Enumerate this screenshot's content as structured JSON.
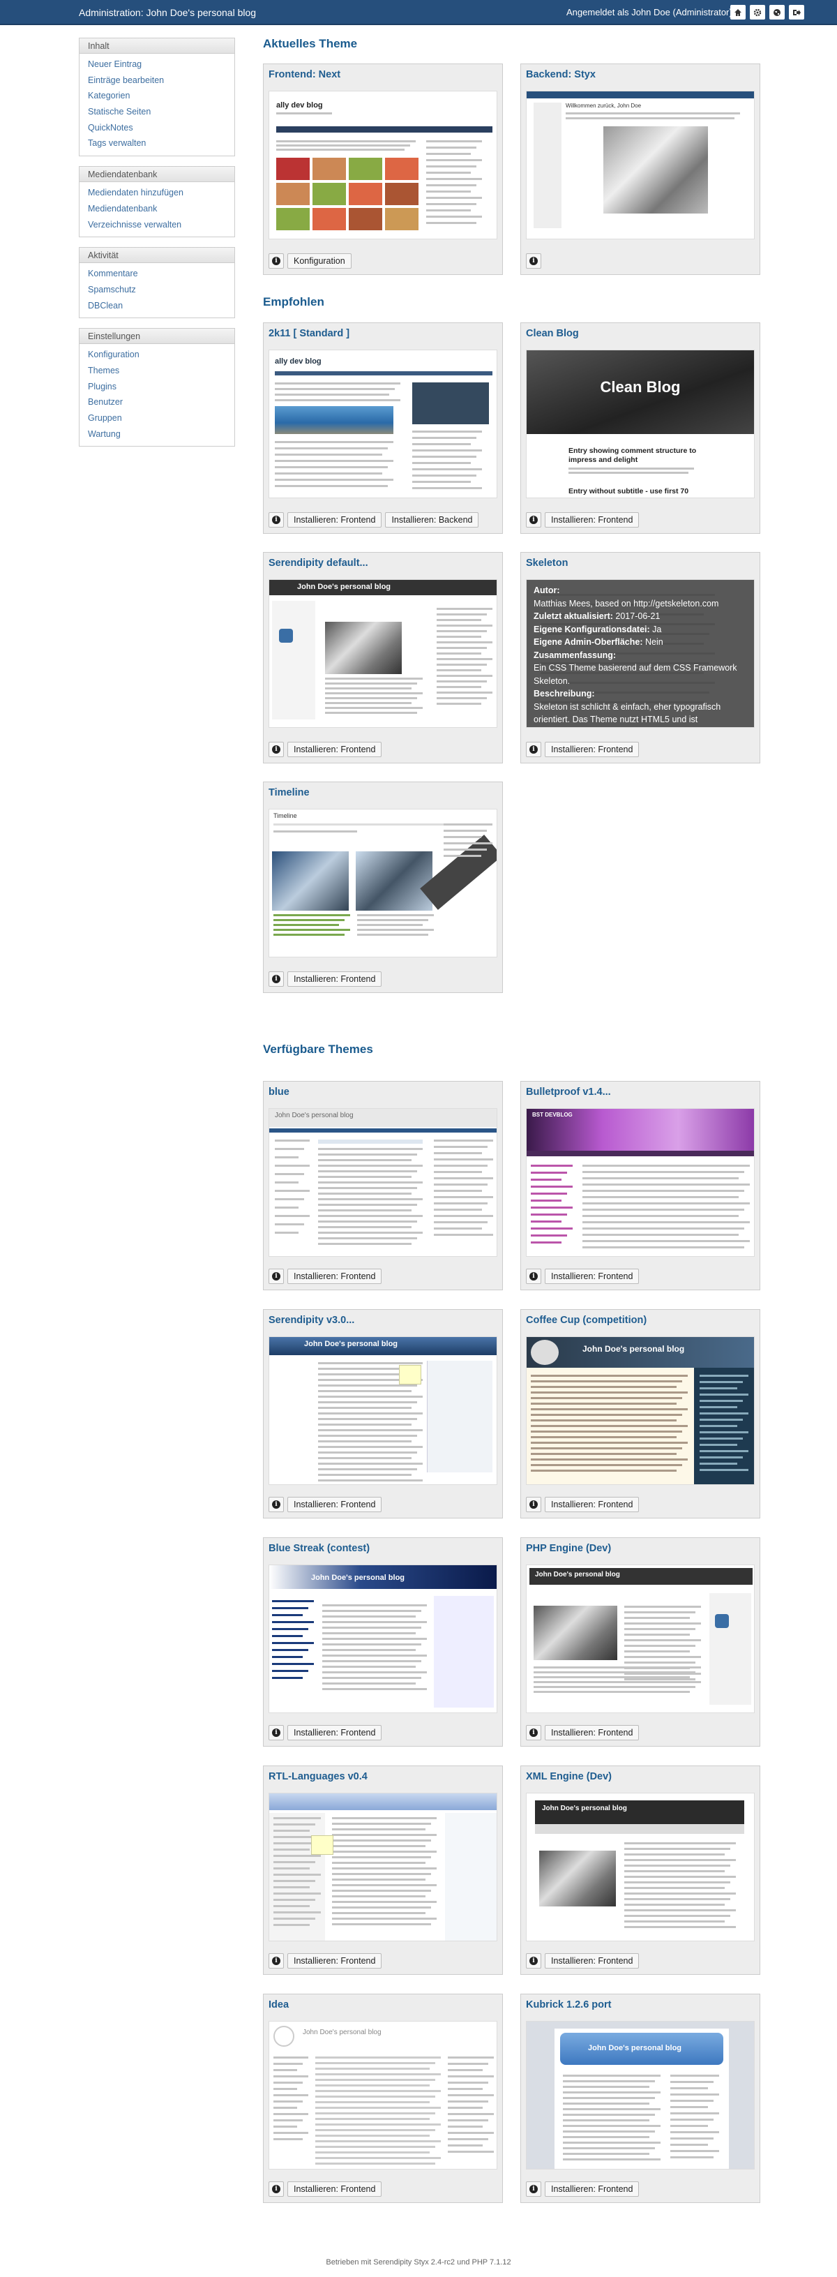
{
  "header": {
    "title": "Administration: John Doe's personal blog",
    "login": "Angemeldet als John Doe (Administrator)",
    "icons": [
      "home-icon",
      "settings-icon",
      "globe-icon",
      "logout-icon"
    ]
  },
  "sidebar": [
    {
      "title": "Inhalt",
      "items": [
        "Neuer Eintrag",
        "Einträge bearbeiten",
        "Kategorien",
        "Statische Seiten",
        "QuickNotes",
        "Tags verwalten"
      ]
    },
    {
      "title": "Mediendatenbank",
      "items": [
        "Mediendaten hinzufügen",
        "Mediendatenbank",
        "Verzeichnisse verwalten"
      ]
    },
    {
      "title": "Aktivität",
      "items": [
        "Kommentare",
        "Spamschutz",
        "DBClean"
      ]
    },
    {
      "title": "Einstellungen",
      "items": [
        "Konfiguration",
        "Themes",
        "Plugins",
        "Benutzer",
        "Gruppen",
        "Wartung"
      ]
    }
  ],
  "sections": {
    "current": "Aktuelles Theme",
    "recommended": "Empfohlen",
    "available": "Verfügbare Themes"
  },
  "info_label": "i",
  "current": [
    {
      "title": "Frontend: Next",
      "buttons": [
        "Konfiguration"
      ]
    },
    {
      "title": "Backend: Styx",
      "buttons": []
    }
  ],
  "previews": {
    "next_blog": "ally dev blog",
    "styx_welcome": "Willkommen zurück, John Doe",
    "clean_title": "Clean Blog",
    "clean_post1": "Entry showing comment structure to impress and delight",
    "clean_post2": "Entry without subtitle - use first 70",
    "jd_blog": "John Doe's personal blog",
    "bulletproof": "BST DEVBLOG",
    "timeline": "Timeline",
    "s2k11": "ally dev blog"
  },
  "skeleton_overlay": {
    "author_label": "Autor:",
    "author": "Matthias Mees, based on http://getskeleton.com",
    "updated_label": "Zuletzt aktualisiert:",
    "updated": "2017-06-21",
    "config_label": "Eigene Konfigurationsdatei:",
    "config": "Ja",
    "admin_label": "Eigene Admin-Oberfläche:",
    "admin": "Nein",
    "summary_label": "Zusammenfassung:",
    "summary": "Ein CSS Theme basierend auf dem CSS Framework Skeleton.",
    "desc_label": "Beschreibung:",
    "desc": "Skeleton ist schlicht & einfach, eher typografisch orientiert. Das Theme nutzt HTML5 und ist"
  },
  "recommended": [
    {
      "title": "2k11 [ Standard ]",
      "buttons": [
        "Installieren: Frontend",
        "Installieren: Backend"
      ]
    },
    {
      "title": "Clean Blog",
      "buttons": [
        "Installieren: Frontend"
      ]
    },
    {
      "title": "Serendipity default...",
      "buttons": [
        "Installieren: Frontend"
      ]
    },
    {
      "title": "Skeleton",
      "buttons": [
        "Installieren: Frontend"
      ]
    },
    {
      "title": "Timeline",
      "buttons": [
        "Installieren: Frontend"
      ]
    }
  ],
  "available": [
    {
      "title": "blue",
      "buttons": [
        "Installieren: Frontend"
      ]
    },
    {
      "title": "Bulletproof v1.4...",
      "buttons": [
        "Installieren: Frontend"
      ]
    },
    {
      "title": "Serendipity v3.0...",
      "buttons": [
        "Installieren: Frontend"
      ]
    },
    {
      "title": "Coffee Cup (competition)",
      "buttons": [
        "Installieren: Frontend"
      ]
    },
    {
      "title": "Blue Streak (contest)",
      "buttons": [
        "Installieren: Frontend"
      ]
    },
    {
      "title": "PHP Engine (Dev)",
      "buttons": [
        "Installieren: Frontend"
      ]
    },
    {
      "title": "RTL-Languages v0.4",
      "buttons": [
        "Installieren: Frontend"
      ]
    },
    {
      "title": "XML Engine (Dev)",
      "buttons": [
        "Installieren: Frontend"
      ]
    },
    {
      "title": "Idea",
      "buttons": [
        "Installieren: Frontend"
      ]
    },
    {
      "title": "Kubrick 1.2.6 port",
      "buttons": [
        "Installieren: Frontend"
      ]
    }
  ],
  "footer": "Betrieben mit Serendipity Styx 2.4-rc2 und PHP 7.1.12"
}
